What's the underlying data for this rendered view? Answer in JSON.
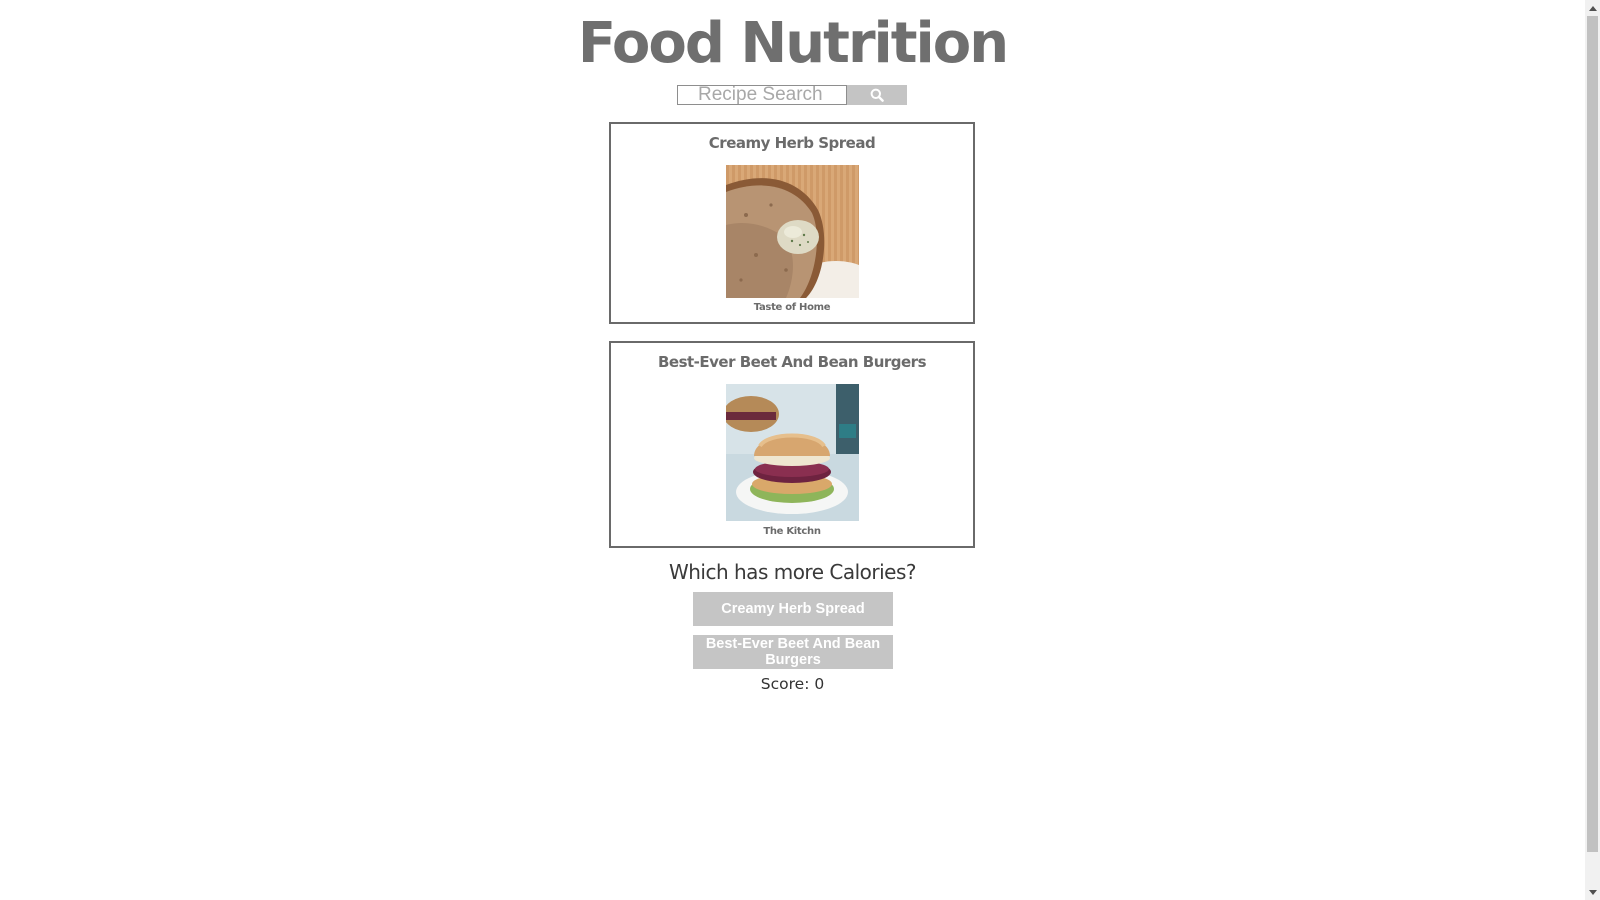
{
  "app": {
    "title": "Food Nutrition"
  },
  "search": {
    "placeholder": "Recipe Search",
    "value": "",
    "button_icon": "search-icon"
  },
  "recipes": [
    {
      "title": "Creamy Herb Spread",
      "source": "Taste of Home",
      "image": "bread-with-herb-spread-photo"
    },
    {
      "title": "Best-Ever Beet And Bean Burgers",
      "source": "The Kitchn",
      "image": "beet-burger-photo"
    }
  ],
  "quiz": {
    "question": "Which has more Calories?",
    "choices": [
      "Creamy Herb Spread",
      "Best-Ever Beet And Bean Burgers"
    ],
    "score_text": "Score: 0"
  },
  "colors": {
    "title": "#6f6f6f",
    "button_bg": "#c5c5c5",
    "card_border": "#6a6a6a"
  }
}
